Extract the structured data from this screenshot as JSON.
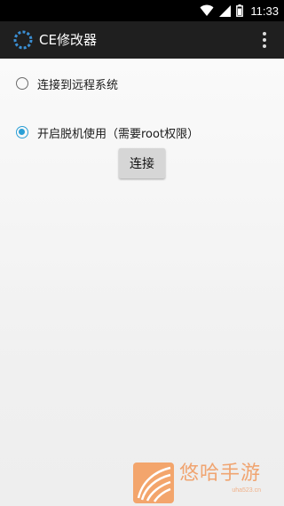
{
  "status_bar": {
    "time": "11:33",
    "icons": [
      "wifi-icon",
      "signal-icon",
      "battery-icon"
    ]
  },
  "toolbar": {
    "title": "CE修改器",
    "icon": "app-loading-icon",
    "menu_icon": "overflow-menu-icon"
  },
  "options": {
    "remote": {
      "label": "连接到远程系统",
      "checked": false
    },
    "local": {
      "label": "开启脱机使用（需要root权限）",
      "checked": true
    }
  },
  "connect_button": {
    "label": "连接"
  },
  "watermark": {
    "title": "悠哈手游",
    "url": "uha523.cn"
  },
  "colors": {
    "status_bar": "#000000",
    "toolbar": "#1f1f1f",
    "accent": "#2a9fd6",
    "watermark": "#f0a470"
  }
}
